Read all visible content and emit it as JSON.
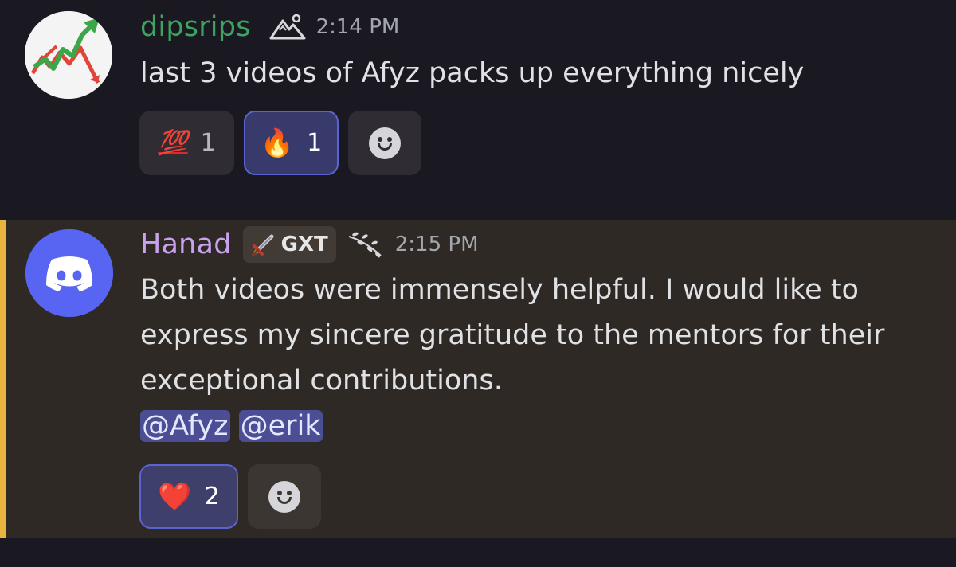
{
  "messages": [
    {
      "username": "dipsrips",
      "user_color": "#3ea360",
      "timestamp": "2:14 PM",
      "badge_icon": "mountains-icon",
      "avatar_icon": "stock-chart-arrow-icon",
      "text_lines": [
        "last 3 videos of Afyz packs up everything nicely"
      ],
      "reactions": [
        {
          "emoji": "💯",
          "count": "1",
          "active": false
        },
        {
          "emoji": "🔥",
          "count": "1",
          "active": true
        }
      ]
    },
    {
      "username": "Hanad",
      "user_color": "#c8a2ec",
      "tag_icon": "sword-icon",
      "tag": "GXT",
      "badge_icon": "branch-icon",
      "timestamp": "2:15 PM",
      "avatar_icon": "discord-logo-icon",
      "text_lines": [
        "Both videos were immensely helpful. I would like to",
        "express my sincere gratitude to the mentors for their",
        "exceptional contributions."
      ],
      "mentions": [
        "@Afyz",
        "@erik"
      ],
      "reactions": [
        {
          "emoji": "❤️",
          "count": "2",
          "active": true
        }
      ],
      "highlight_color": "#e8b33f"
    }
  ]
}
